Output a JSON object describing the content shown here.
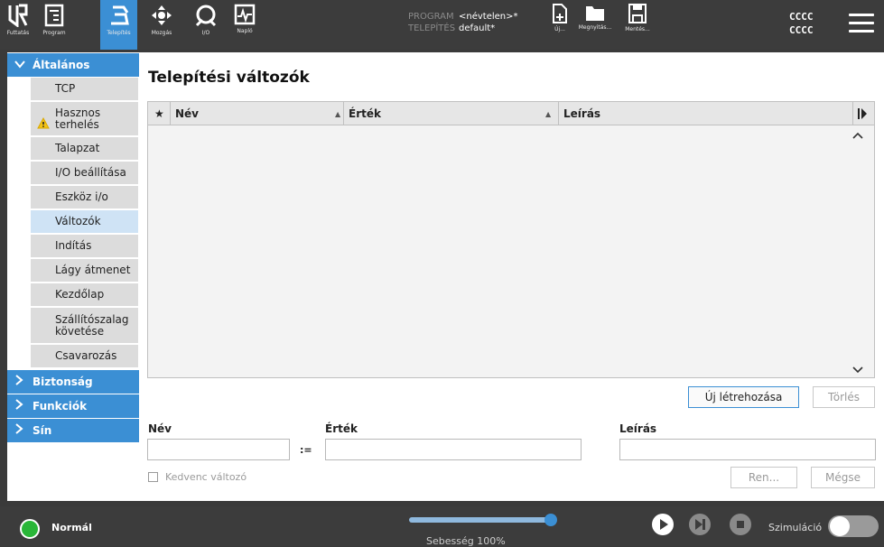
{
  "topbar": {
    "nav": [
      {
        "label": "Futtatás",
        "icon": "ur-logo-icon"
      },
      {
        "label": "Program",
        "icon": "program-icon"
      },
      {
        "label": "Telepítés",
        "icon": "installation-icon"
      },
      {
        "label": "Mozgás",
        "icon": "move-icon"
      },
      {
        "label": "I/O",
        "icon": "io-icon"
      },
      {
        "label": "Napló",
        "icon": "log-icon"
      }
    ],
    "program_key": "PROGRAM",
    "program_value": "<névtelen>*",
    "installation_key": "TELEPÍTÉS",
    "installation_value": "default*",
    "file_buttons": [
      {
        "label": "Új...",
        "icon": "new-file-icon"
      },
      {
        "label": "Megnyitás...",
        "icon": "folder-icon"
      },
      {
        "label": "Mentés...",
        "icon": "save-icon"
      }
    ],
    "robot_id_1": "CCCC",
    "robot_id_2": "CCCC"
  },
  "sidebar": {
    "sections": [
      {
        "label": "Általános",
        "expanded": true
      },
      {
        "label": "Biztonság",
        "expanded": false
      },
      {
        "label": "Funkciók",
        "expanded": false
      },
      {
        "label": "Sín",
        "expanded": false
      }
    ],
    "items": [
      {
        "label": "TCP"
      },
      {
        "label": "Hasznos terhelés",
        "warning": true
      },
      {
        "label": "Talapzat"
      },
      {
        "label": "I/O beállítása"
      },
      {
        "label": "Eszköz i/o"
      },
      {
        "label": "Változók",
        "selected": true
      },
      {
        "label": "Indítás"
      },
      {
        "label": "Lágy átmenet"
      },
      {
        "label": "Kezdőlap"
      },
      {
        "label": "Szállítószalag követése"
      },
      {
        "label": "Csavarozás"
      }
    ]
  },
  "main": {
    "title": "Telepítési változók",
    "table": {
      "columns": [
        "★",
        "Név",
        "Érték",
        "Leírás"
      ],
      "rows": []
    },
    "create_button": "Új létrehozása",
    "delete_button": "Törlés",
    "name_label": "Név",
    "value_label": "Érték",
    "description_label": "Leírás",
    "assign_symbol": ":=",
    "favorite_label": "Kedvenc változó",
    "rename_button": "Ren...",
    "cancel_button": "Mégse"
  },
  "bottombar": {
    "status": "Normál",
    "status_color": "#29b638",
    "speed_label": "Sebesség 100%",
    "speed_percent": 100,
    "simulation_label": "Szimuláció",
    "simulation_on": false
  },
  "colors": {
    "accent": "#3b8fd4",
    "bar": "#3c3c3c"
  }
}
